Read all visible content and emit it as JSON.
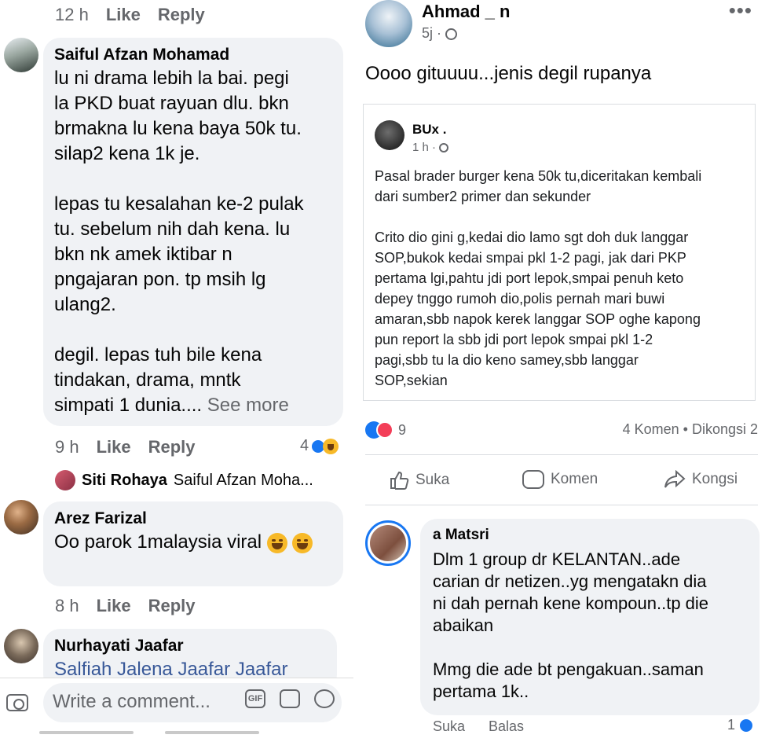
{
  "left": {
    "top_meta": {
      "time": "12 h",
      "like": "Like",
      "reply": "Reply"
    },
    "comments": [
      {
        "name": "Saiful Afzan Mohamad",
        "text": "lu ni drama lebih la bai. pegi\nla PKD buat rayuan dlu. bkn\nbrmakna lu kena baya 50k tu.\nsilap2 kena 1k je.\n\nlepas tu kesalahan ke-2 pulak\ntu. sebelum nih dah kena. lu\nbkn nk amek iktibar n\npngajaran pon. tp msih lg\nulang2.\n\ndegil. lepas tuh bile kena\ntindakan, drama, mntk\nsimpati 1 dunia....",
        "see_more": "See more",
        "time": "9 h",
        "like": "Like",
        "reply": "Reply",
        "reactions": "4"
      },
      {
        "name": "Arez Farizal",
        "text": "Oo parok 1malaysia viral",
        "time": "8 h",
        "like": "Like",
        "reply": "Reply"
      },
      {
        "name": "Nurhayati Jaafar",
        "text": "Salfiah Jalena Jaafar Jaafar"
      }
    ],
    "reply_preview": {
      "name": "Siti Rohaya",
      "text": "Saiful Afzan Moha..."
    },
    "composer": {
      "placeholder": "Write a comment...",
      "gif": "GIF"
    }
  },
  "right": {
    "post": {
      "author": "Ahmad _      n",
      "time": "5j ·",
      "text": "Oooo gituuuu...jenis degil rupanya",
      "more": "•••"
    },
    "shared": {
      "author": "BUx .",
      "time": "1 h ·",
      "text": "Pasal brader burger kena 50k tu,diceritakan kembali\ndari sumber2 primer dan sekunder\n\nCrito dio gini g,kedai dio lamo sgt doh duk langgar\nSOP,bukok kedai smpai pkl 1-2 pagi, jak dari PKP\npertama lgi,pahtu jdi port lepok,smpai penuh keto\ndepey tnggo rumoh dio,polis pernah mari buwi\namaran,sbb napok kerek langgar SOP oghe kapong\npun report la sbb jdi port lepok smpai pkl 1-2\npagi,sbb tu la dio keno samey,sbb langgar\nSOP,sekian"
    },
    "counts": {
      "reactions": "9",
      "comments_shares": "4 Komen • Dikongsi 2"
    },
    "actions": {
      "like": "Suka",
      "comment": "Komen",
      "share": "Kongsi"
    },
    "reply": {
      "name": "a Matsri",
      "text": "Dlm 1 group dr KELANTAN..ade\ncarian dr netizen..yg mengatakn dia\nni dah pernah kene kompoun..tp die\nabaikan\n\nMmg die ade bt pengakuan..saman\npertama 1k..",
      "like": "Suka",
      "reply": "Balas",
      "count": "1"
    }
  }
}
